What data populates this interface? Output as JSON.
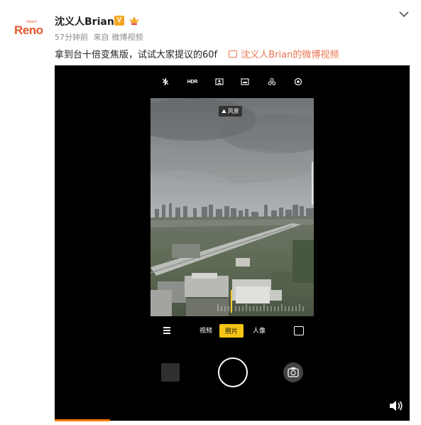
{
  "post": {
    "avatar_brand": "Reno",
    "avatar_small": "Smart",
    "author": "沈义人Brian",
    "verified_badge": "V",
    "time": "57分钟前",
    "source_prefix": "来自",
    "source": "微博视频",
    "text": "拿到台十倍变焦版，试试大家提议的60f",
    "video_link": "沈义人Brian的微博视频"
  },
  "camera": {
    "top_icons": [
      "flash-off-icon",
      "hdr-label",
      "portrait-mode-icon",
      "gallery-filter-icon",
      "ai-scene-icon",
      "settings-icon"
    ],
    "hdr_label": "HDR",
    "scene_label": "风景",
    "modes": [
      "视频",
      "照片",
      "人像"
    ],
    "active_mode": "照片"
  },
  "video": {
    "progress": 0.156
  },
  "colors": {
    "accent": "#eb7350",
    "progress": "#ff8200",
    "camera_mode_active": "#f3c316",
    "vip_badge": "#f5a623"
  }
}
